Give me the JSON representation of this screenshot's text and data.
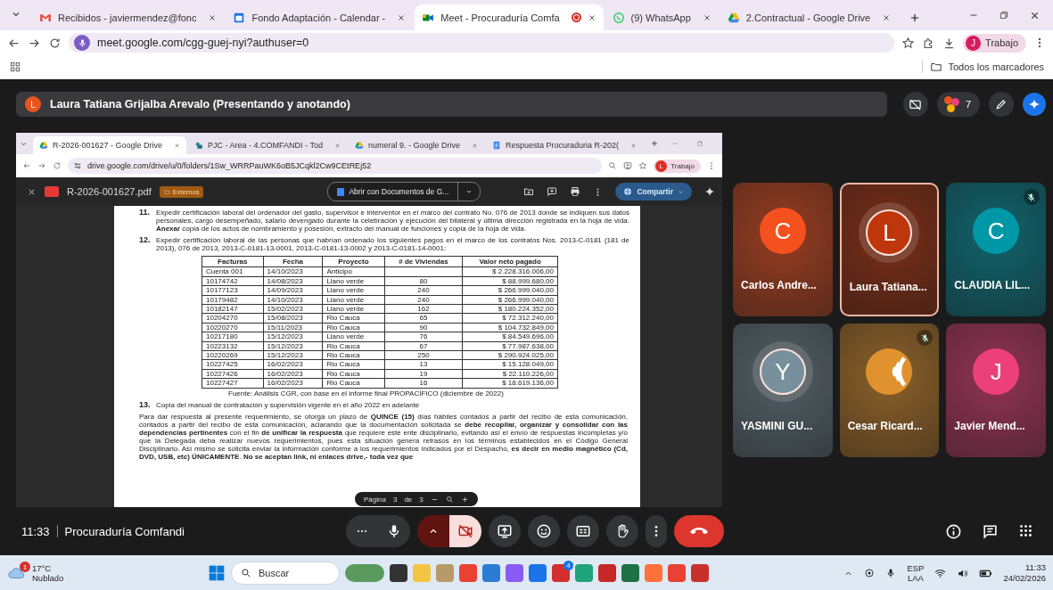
{
  "browser": {
    "tabs": [
      {
        "title": "Recibidos - javiermendez@fonc",
        "kind": "gmail",
        "selected": false,
        "recording": false
      },
      {
        "title": "Fondo Adaptación - Calendar -",
        "kind": "calendar",
        "selected": false,
        "recording": false
      },
      {
        "title": "Meet - Procuraduría Comfa",
        "kind": "meet",
        "selected": true,
        "recording": true
      },
      {
        "title": "(9) WhatsApp",
        "kind": "whatsapp",
        "selected": false,
        "recording": false
      },
      {
        "title": "2.Contractual - Google Drive",
        "kind": "drive",
        "selected": false,
        "recording": false
      }
    ],
    "url": "meet.google.com/cgg-guej-nyi?authuser=0",
    "profile": {
      "initial": "J",
      "label": "Trabajo"
    },
    "bookmarks_folder": "Todos los marcadores"
  },
  "meet": {
    "presenter": {
      "initial": "L",
      "banner": "Laura Tatiana Grijalba Arevalo (Presentando y anotando)"
    },
    "participant_count": "7",
    "shared_screen": {
      "tabs": [
        {
          "title": "R-2026-001627 - Google Drive",
          "kind": "drive",
          "selected": true
        },
        {
          "title": "PJC - Area - 4.COMFANDI - Tod",
          "kind": "sites",
          "selected": false
        },
        {
          "title": "numeral 9. - Google Drive",
          "kind": "drive",
          "selected": false
        },
        {
          "title": "Respuesta Procuraduria R-202(",
          "kind": "docs",
          "selected": false
        }
      ],
      "url": "drive.google.com/drive/u/0/folders/1Sw_WRRPauWK6oB5JCqkl2Cw9CEtREj52",
      "profile": {
        "initial": "L",
        "label": "Trabajo"
      },
      "file": {
        "name": "R-2026-001627.pdf",
        "badge": "Externos",
        "open_with": "Abrir con Documentos de G...",
        "share": "Compartir"
      },
      "document": {
        "item_11": {
          "number": "11.",
          "text": "Expedir certificación laboral del ordenador del gasto, supervisor e interventor en el marco del contrato No. 076 de 2013 donde se indiquen sus datos personales, cargo desempeñado, salario devengado durante la celebración y ejecución del bilateral y última dirección registrada en la hoja de vida. **Anexar** copia de los actos de nombramiento y posesión, extracto del manual de funciones y copia de la hoja de vida."
        },
        "item_12": {
          "number": "12.",
          "text": "Expedir certificación laboral de las personas que habrían ordenado los siguientes pagos en el marco de los contratos Nos. 2013-C-0181 (181 de 2013), 076 de 2013, 2013-C-0181-13-0001, 2013-C-0181-13-0002 y 2013-C-0181-14-0001:"
        },
        "table": {
          "columns": [
            "Facturas",
            "Fecha",
            "Proyecto",
            "# de Viviendas",
            "Valor neto pagado"
          ],
          "rows": [
            [
              "Cuenta 001",
              "14/10/2023",
              "Anticipo",
              "",
              "$ 2.228.316.006,00"
            ],
            [
              "10174742",
              "14/08/2023",
              "Llano verde",
              "80",
              "$ 88.999.680,00"
            ],
            [
              "10177123",
              "14/09/2023",
              "Llano verde",
              "240",
              "$ 266.999.040,00"
            ],
            [
              "10179482",
              "14/10/2023",
              "Llano verde",
              "240",
              "$ 266.999.040,00"
            ],
            [
              "10182147",
              "15/02/2023",
              "Llano verde",
              "162",
              "$ 180.224.352,00"
            ],
            [
              "10204270",
              "15/08/2023",
              "Rio Cauca",
              "65",
              "$ 72.312.240,00"
            ],
            [
              "10220270",
              "15/11/2023",
              "Rio Cauca",
              "90",
              "$ 104.732.849,00"
            ],
            [
              "10217180",
              "15/12/2023",
              "Llano verde",
              "76",
              "$ 84.549.696,00"
            ],
            [
              "10223132",
              "15/12/2023",
              "Rio Cauca",
              "67",
              "$ 77.987.638,00"
            ],
            [
              "10220269",
              "15/12/2023",
              "Rio Cauca",
              "250",
              "$ 290.924.025,00"
            ],
            [
              "10227425",
              "16/02/2023",
              "Rio Cauca",
              "13",
              "$ 15.128.049,00"
            ],
            [
              "10227426",
              "16/02/2023",
              "Rio Cauca",
              "19",
              "$ 22.110.226,00"
            ],
            [
              "10227427",
              "16/02/2023",
              "Rio Cauca",
              "16",
              "$ 18.619.136,00"
            ]
          ]
        },
        "table_source": "Fuente: Análisis CGR, con base en el informe final PROPACÍFICO (diciembre de 2022)",
        "item_13": {
          "number": "13.",
          "text": "Copia del manual de contratación y supervisión vigente en el año 2022 en adelante"
        },
        "closing_paragraph": "Para dar respuesta al presente requerimiento, se otorga un plazo de **QUINCE (15)** días hábiles contados a partir del recibo de esta comunicación, contados a partir del recibo de esta comunicación, aclarando que la documentación solicitada se **debe recopilar, organizar y consolidar con las dependencias pertinentes** con el fin **de unificar la respuesta** que requiere este ente disciplinario, evitando así el envío de respuestas incompletas y/o que la Delegada deba realizar nuevos requerimientos, pues esta situación genera retrasos en los términos establecidos en el Código General Disciplinario. Así mismo se solicita enviar la información conforme a los requerimientos indicados por el Despacho, **es decir en medio magnético (Cd, DVD, USB, etc) ÚNICAMENTE**. **No se aceptan link, ni enlaces drive,- toda vez que**"
      },
      "page_indicator": {
        "label": "Página",
        "current": "3",
        "separator": "de",
        "total": "3"
      }
    },
    "participants": [
      {
        "name": "Carlos Andre...",
        "initial": "C",
        "kind": "initial",
        "color": "#f4511e",
        "muted": false,
        "speaking": false,
        "highlighted": false
      },
      {
        "name": "Laura Tatiana...",
        "initial": "L",
        "kind": "initial",
        "color": "#bf360c",
        "muted": false,
        "speaking": true,
        "highlighted": true
      },
      {
        "name": "CLAUDIA LIL...",
        "initial": "C",
        "kind": "initial",
        "color": "#0097a7",
        "muted": true,
        "speaking": false,
        "highlighted": false
      },
      {
        "name": "YASMINI GU...",
        "initial": "Y",
        "kind": "initial",
        "color": "#78909c",
        "muted": false,
        "speaking": true,
        "highlighted": false
      },
      {
        "name": "Cesar Ricard...",
        "kind": "image",
        "color": "#e0922e",
        "muted": true,
        "speaking": false,
        "highlighted": false
      },
      {
        "name": "Javier Mend...",
        "initial": "J",
        "kind": "initial",
        "color": "#ec407a",
        "muted": false,
        "speaking": false,
        "highlighted": false
      }
    ],
    "time": "11:33",
    "meeting_name": "Procuraduría Comfandi",
    "mic_on": true,
    "camera_on": false
  },
  "taskbar": {
    "weather": {
      "badge": "1",
      "temperature": "17°C",
      "condition": "Nublado"
    },
    "search": "Buscar",
    "apps": [
      {
        "color": "#5a9a5e"
      },
      {
        "color": "#333333"
      },
      {
        "color": "#f4c542"
      },
      {
        "color": "#b89a6a"
      },
      {
        "color": "#e94235"
      },
      {
        "color": "#2b7cd3"
      },
      {
        "color": "#8a5cf6"
      },
      {
        "color": "#1a73e8"
      },
      {
        "color": "#d32f2f",
        "badge": "4"
      },
      {
        "color": "#1fa37a"
      },
      {
        "color": "#c62828"
      },
      {
        "color": "#1e7145"
      },
      {
        "color": "#ff7139"
      },
      {
        "color": "#e94235"
      },
      {
        "color": "#c9302c"
      }
    ],
    "language": "ESP",
    "layout": "LAA",
    "time": "11:33",
    "date": "24/02/2026"
  }
}
